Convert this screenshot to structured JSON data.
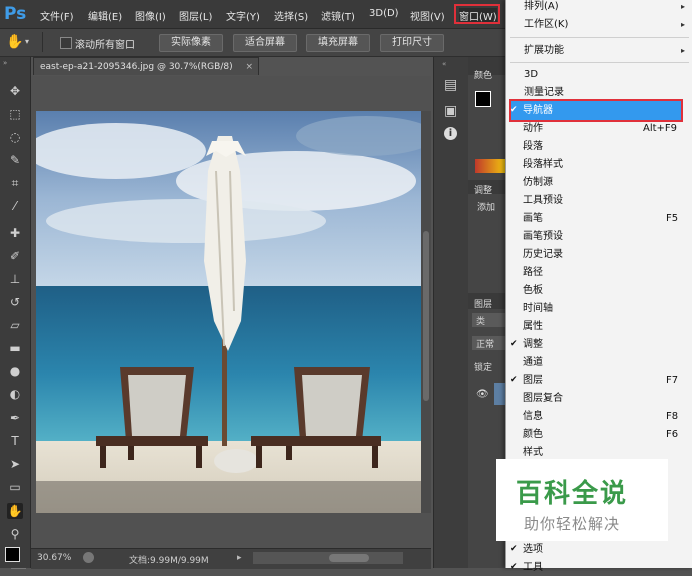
{
  "app": {
    "logo": "Ps"
  },
  "menubar": {
    "items": [
      "文件(F)",
      "编辑(E)",
      "图像(I)",
      "图层(L)",
      "文字(Y)",
      "选择(S)",
      "滤镜(T)",
      "3D(D)",
      "视图(V)",
      "窗口(W)"
    ]
  },
  "options": {
    "scroll_all_label": "滚动所有窗口",
    "buttons": [
      "实际像素",
      "适合屏幕",
      "填充屏幕",
      "打印尺寸"
    ]
  },
  "document": {
    "tab_title": "east-ep-a21-2095346.jpg @ 30.7%(RGB/8)",
    "zoom": "30.67%",
    "doc_info": "文档:9.99M/9.99M"
  },
  "panels": {
    "color_tab": "颜色",
    "adjust_tab": "调整",
    "adjust_sub": "添加",
    "layers_tab": "图层",
    "layers_search": "类",
    "blend": "正常",
    "lock": "锁定"
  },
  "window_menu": {
    "items": [
      {
        "label": "排列(A)",
        "submenu": true
      },
      {
        "label": "工作区(K)",
        "submenu": true
      },
      {
        "label": "扩展功能",
        "submenu": true
      },
      {
        "label": "3D"
      },
      {
        "label": "测量记录"
      },
      {
        "label": "导航器",
        "checked": true,
        "highlighted": true
      },
      {
        "label": "动作",
        "shortcut": "Alt+F9"
      },
      {
        "label": "段落"
      },
      {
        "label": "段落样式"
      },
      {
        "label": "仿制源"
      },
      {
        "label": "工具预设"
      },
      {
        "label": "画笔",
        "shortcut": "F5"
      },
      {
        "label": "画笔预设"
      },
      {
        "label": "历史记录"
      },
      {
        "label": "路径"
      },
      {
        "label": "色板"
      },
      {
        "label": "时间轴"
      },
      {
        "label": "属性"
      },
      {
        "label": "调整",
        "checked": true
      },
      {
        "label": "通道"
      },
      {
        "label": "图层",
        "checked": true,
        "shortcut": "F7"
      },
      {
        "label": "图层复合"
      },
      {
        "label": "信息",
        "shortcut": "F8"
      },
      {
        "label": "颜色",
        "shortcut": "F6"
      },
      {
        "label": "样式"
      },
      {
        "label": "选项",
        "checked": true
      },
      {
        "label": "工具",
        "checked": true
      }
    ]
  },
  "watermark": {
    "title": "百科全说",
    "subtitle": "助你轻松解决"
  },
  "colors": {
    "accent": "#3399ee",
    "highlight_border": "#e0303a",
    "watermark_green": "#3a9a4a"
  }
}
